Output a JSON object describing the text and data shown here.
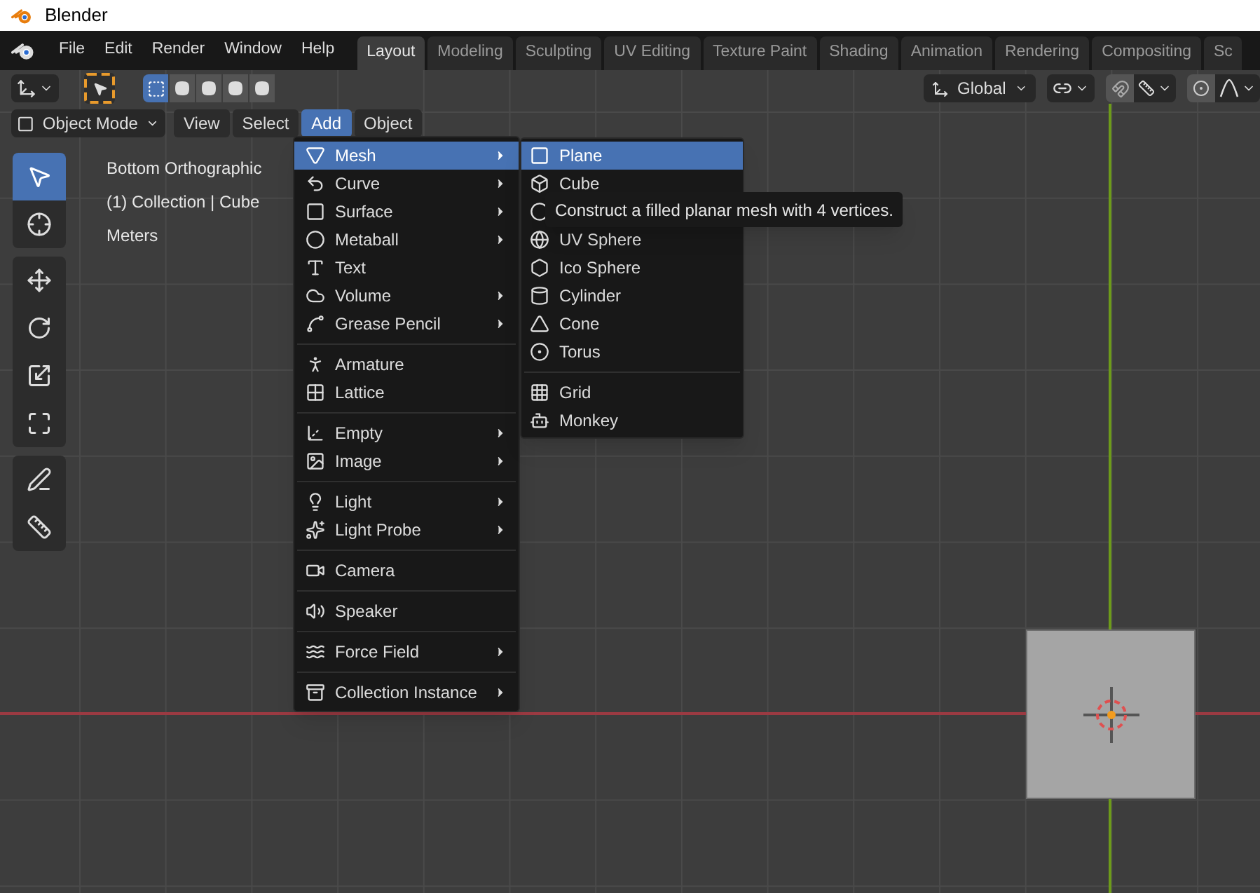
{
  "title_bar": {
    "title": "Blender"
  },
  "menu_bar": {
    "items": [
      "File",
      "Edit",
      "Render",
      "Window",
      "Help"
    ]
  },
  "workspace_tabs": [
    {
      "label": "Layout",
      "selected": true
    },
    {
      "label": "Modeling",
      "selected": false
    },
    {
      "label": "Sculpting",
      "selected": false
    },
    {
      "label": "UV Editing",
      "selected": false
    },
    {
      "label": "Texture Paint",
      "selected": false
    },
    {
      "label": "Shading",
      "selected": false
    },
    {
      "label": "Animation",
      "selected": false
    },
    {
      "label": "Rendering",
      "selected": false
    },
    {
      "label": "Compositing",
      "selected": false
    },
    {
      "label": "Sc",
      "selected": false
    }
  ],
  "tool_header": {
    "select_modes": [
      {
        "selected": true
      },
      {
        "selected": false
      },
      {
        "selected": false
      },
      {
        "selected": false
      },
      {
        "selected": false
      }
    ],
    "orientation": "Global"
  },
  "viewport_header": {
    "mode": "Object Mode",
    "menus": [
      {
        "label": "View",
        "selected": false
      },
      {
        "label": "Select",
        "selected": false
      },
      {
        "label": "Add",
        "selected": true
      },
      {
        "label": "Object",
        "selected": false
      }
    ]
  },
  "toolbar": {
    "groups": [
      [
        {
          "selected": true
        },
        {
          "selected": false
        }
      ],
      [
        {
          "selected": false
        },
        {
          "selected": false
        },
        {
          "selected": false
        },
        {
          "selected": false
        }
      ],
      [
        {
          "selected": false
        },
        {
          "selected": false
        }
      ]
    ]
  },
  "overlay_text": [
    "Bottom Orthographic",
    "(1) Collection | Cube",
    "Meters"
  ],
  "add_menu": {
    "sections": [
      [
        {
          "label": "Mesh",
          "submenu": true,
          "selected": true
        },
        {
          "label": "Curve",
          "submenu": true,
          "selected": false
        },
        {
          "label": "Surface",
          "submenu": true,
          "selected": false
        },
        {
          "label": "Metaball",
          "submenu": true,
          "selected": false
        },
        {
          "label": "Text",
          "submenu": false,
          "selected": false
        },
        {
          "label": "Volume",
          "submenu": true,
          "selected": false
        },
        {
          "label": "Grease Pencil",
          "submenu": true,
          "selected": false
        }
      ],
      [
        {
          "label": "Armature",
          "submenu": false,
          "selected": false
        },
        {
          "label": "Lattice",
          "submenu": false,
          "selected": false
        }
      ],
      [
        {
          "label": "Empty",
          "submenu": true,
          "selected": false
        },
        {
          "label": "Image",
          "submenu": true,
          "selected": false
        }
      ],
      [
        {
          "label": "Light",
          "submenu": true,
          "selected": false
        },
        {
          "label": "Light Probe",
          "submenu": true,
          "selected": false
        }
      ],
      [
        {
          "label": "Camera",
          "submenu": false,
          "selected": false
        }
      ],
      [
        {
          "label": "Speaker",
          "submenu": false,
          "selected": false
        }
      ],
      [
        {
          "label": "Force Field",
          "submenu": true,
          "selected": false
        }
      ],
      [
        {
          "label": "Collection Instance",
          "submenu": true,
          "selected": false
        }
      ]
    ]
  },
  "mesh_submenu": {
    "sections": [
      [
        {
          "label": "Plane",
          "selected": true
        },
        {
          "label": "Cube",
          "selected": false
        },
        {
          "selected": false
        },
        {
          "label": "UV Sphere",
          "selected": false
        },
        {
          "label": "Ico Sphere",
          "selected": false
        },
        {
          "label": "Cylinder",
          "selected": false
        },
        {
          "label": "Cone",
          "selected": false
        },
        {
          "label": "Torus",
          "selected": false
        }
      ],
      [
        {
          "label": "Grid",
          "selected": false
        },
        {
          "label": "Monkey",
          "selected": false
        }
      ]
    ]
  },
  "tooltip": {
    "text": "Construct a filled planar mesh with 4 vertices."
  }
}
